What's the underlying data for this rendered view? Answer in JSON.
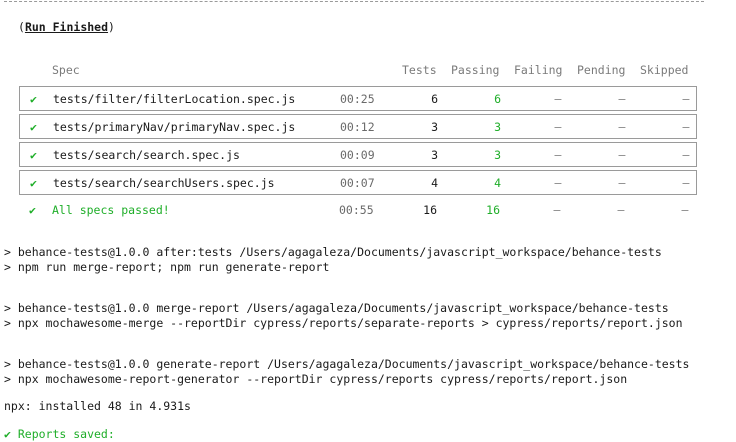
{
  "run_finished": {
    "open": "(",
    "label": "Run Finished",
    "close": ")"
  },
  "table": {
    "headers": {
      "spec": "Spec",
      "tests": "Tests",
      "passing": "Passing",
      "failing": "Failing",
      "pending": "Pending",
      "skipped": "Skipped"
    },
    "rows": [
      {
        "check": "✔",
        "spec": "tests/filter/filterLocation.spec.js",
        "duration": "00:25",
        "tests": "6",
        "passing": "6",
        "failing": "–",
        "pending": "–",
        "skipped": "–"
      },
      {
        "check": "✔",
        "spec": "tests/primaryNav/primaryNav.spec.js",
        "duration": "00:12",
        "tests": "3",
        "passing": "3",
        "failing": "–",
        "pending": "–",
        "skipped": "–"
      },
      {
        "check": "✔",
        "spec": "tests/search/search.spec.js",
        "duration": "00:09",
        "tests": "3",
        "passing": "3",
        "failing": "–",
        "pending": "–",
        "skipped": "–"
      },
      {
        "check": "✔",
        "spec": "tests/search/searchUsers.spec.js",
        "duration": "00:07",
        "tests": "4",
        "passing": "4",
        "failing": "–",
        "pending": "–",
        "skipped": "–"
      }
    ],
    "total": {
      "check": "✔",
      "spec": "All specs passed!",
      "duration": "00:55",
      "tests": "16",
      "passing": "16",
      "failing": "–",
      "pending": "–",
      "skipped": "–"
    }
  },
  "log": [
    "> behance-tests@1.0.0 after:tests /Users/agagaleza/Documents/javascript_workspace/behance-tests",
    "> npm run merge-report; npm run generate-report",
    "> behance-tests@1.0.0 merge-report /Users/agagaleza/Documents/javascript_workspace/behance-tests",
    "> npx mochawesome-merge --reportDir cypress/reports/separate-reports > cypress/reports/report.json",
    "> behance-tests@1.0.0 generate-report /Users/agagaleza/Documents/javascript_workspace/behance-tests",
    "> npx mochawesome-report-generator --reportDir cypress/reports cypress/reports/report.json",
    "npx: installed 48 in 4.931s",
    "✔ Reports saved:"
  ],
  "colors": {
    "success": "#1fae29",
    "muted": "#7a7a7a",
    "border": "#9a9a9a"
  }
}
